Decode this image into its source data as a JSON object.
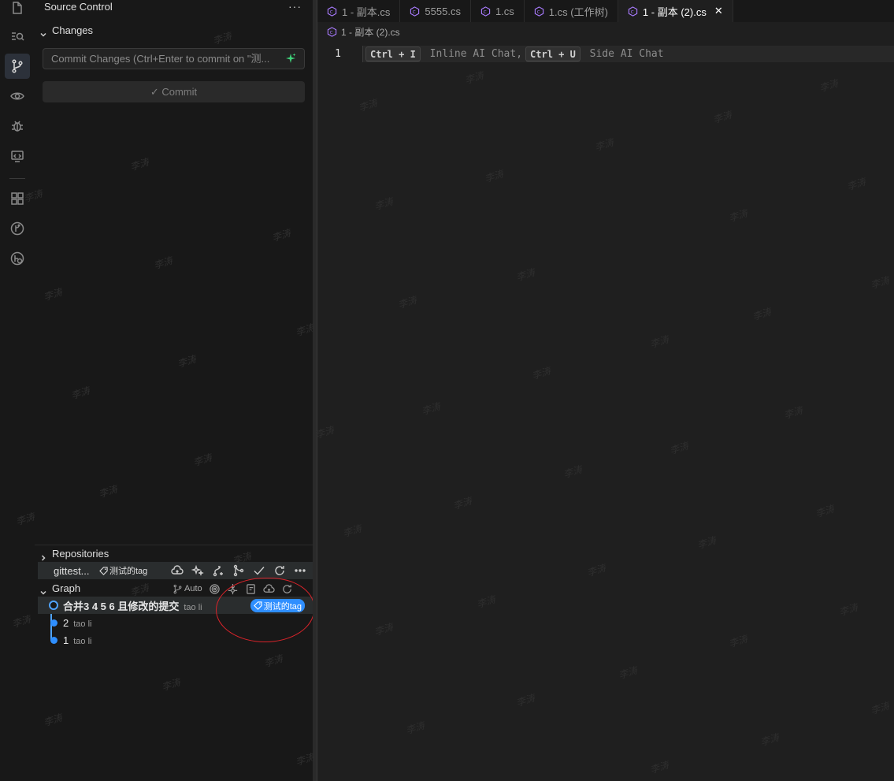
{
  "sidebar": {
    "title": "Source Control",
    "more": "···",
    "changes_header": "Changes",
    "commit_placeholder": "Commit Changes (Ctrl+Enter to commit on \"测...",
    "commit_button": "✓ Commit",
    "repositories_header": "Repositories",
    "repo_name": "gittest...",
    "repo_tag": "测试的tag",
    "graph_header": "Graph",
    "graph_auto": "Auto",
    "commits": [
      {
        "message": "合并3 4 5 6 且修改的提交",
        "author": "tao li",
        "tag": "测试的tag"
      },
      {
        "message": "2",
        "author": "tao li"
      },
      {
        "message": "1",
        "author": "tao li"
      }
    ]
  },
  "editor": {
    "tabs": [
      {
        "label": "1 - 副本.cs"
      },
      {
        "label": "5555.cs"
      },
      {
        "label": "1.cs"
      },
      {
        "label": "1.cs (工作树)"
      },
      {
        "label": "1 - 副本 (2).cs",
        "close": "✕"
      }
    ],
    "breadcrumb": "1 - 副本 (2).cs",
    "line_number": "1",
    "hint": {
      "key1": "Ctrl + I",
      "text1": " Inline AI Chat,",
      "key2": "Ctrl + U",
      "text2": " Side AI Chat"
    }
  },
  "colors": {
    "accent": "#2f8fff",
    "annotation": "#d8232a"
  },
  "watermark": "李涛"
}
